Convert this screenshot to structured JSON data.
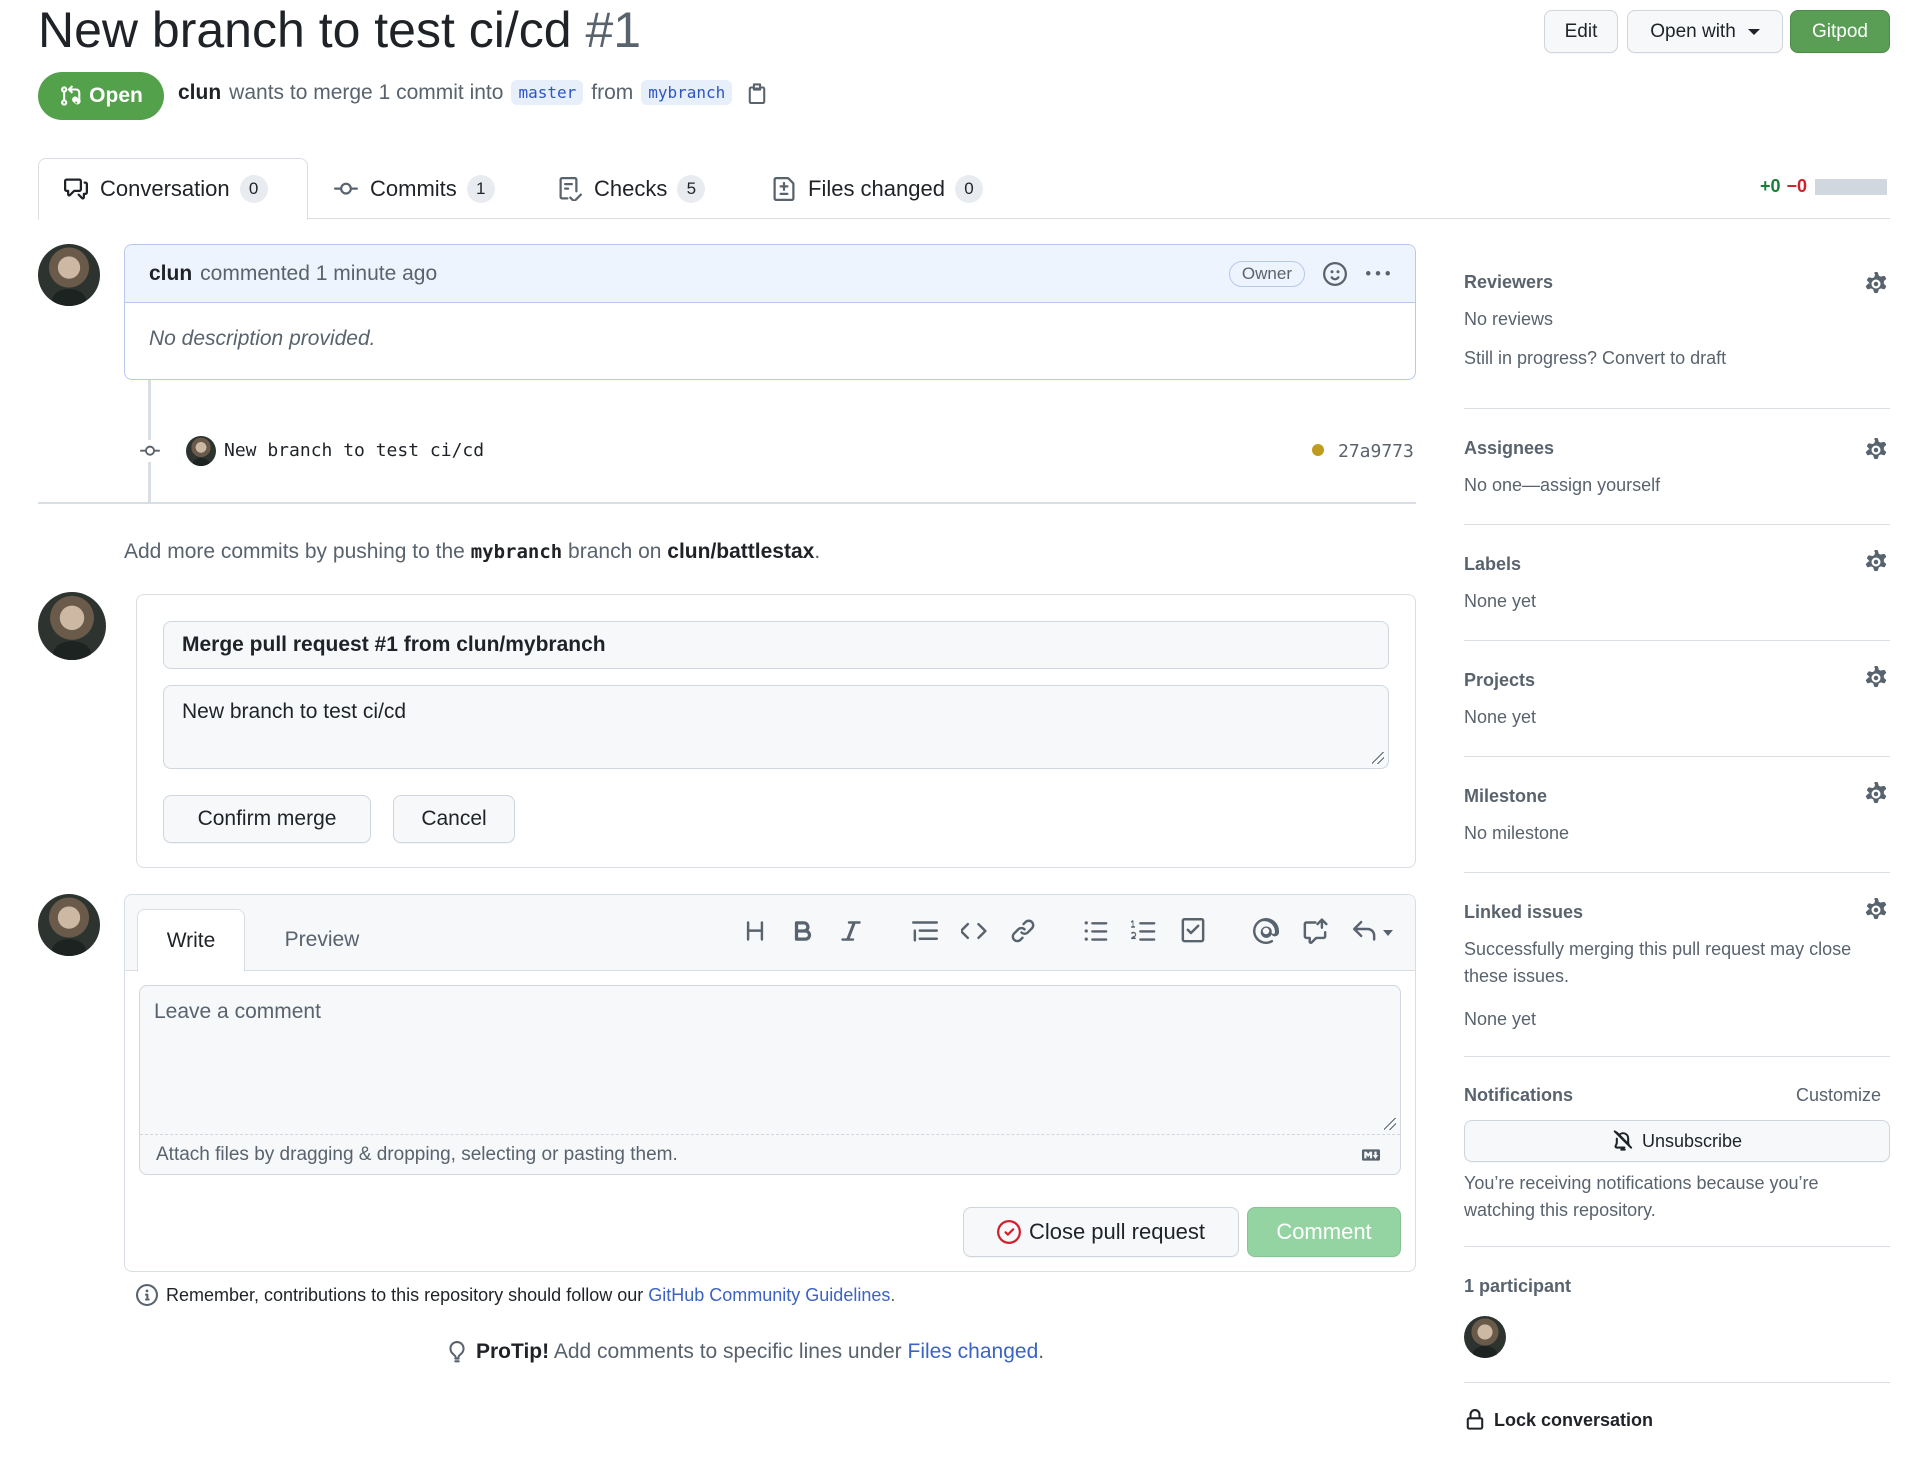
{
  "header": {
    "title": "New branch to test ci/cd",
    "number": "#1",
    "edit_label": "Edit",
    "open_with_label": "Open with",
    "gitpod_label": "Gitpod",
    "state_label": "Open",
    "author": "clun",
    "merge_text": "wants to merge 1 commit into",
    "base_branch": "master",
    "from_text": "from",
    "head_branch": "mybranch"
  },
  "tabs": [
    {
      "label": "Conversation",
      "count": "0"
    },
    {
      "label": "Commits",
      "count": "1"
    },
    {
      "label": "Checks",
      "count": "5"
    },
    {
      "label": "Files changed",
      "count": "0"
    }
  ],
  "diffstat": {
    "additions": "+0",
    "deletions": "−0"
  },
  "comment": {
    "author": "clun",
    "action": "commented 1 minute ago",
    "role_badge": "Owner",
    "body": "No description provided."
  },
  "commit": {
    "message": "New branch to test ci/cd",
    "sha": "27a9773"
  },
  "push_hint": {
    "prefix": "Add more commits by pushing to the",
    "branch": "mybranch",
    "middle": "branch on",
    "repo": "clun/battlestax",
    "suffix": "."
  },
  "merge_form": {
    "title_value": "Merge pull request #1 from clun/mybranch",
    "body_value": "New branch to test ci/cd",
    "confirm_label": "Confirm merge",
    "cancel_label": "Cancel"
  },
  "editor": {
    "write_tab": "Write",
    "preview_tab": "Preview",
    "placeholder": "Leave a comment",
    "attach_text": "Attach files by dragging & dropping, selecting or pasting them.",
    "close_label": "Close pull request",
    "comment_label": "Comment"
  },
  "guidelines": {
    "prefix": "Remember, contributions to this repository should follow our",
    "link": "GitHub Community Guidelines",
    "suffix": "."
  },
  "protip": {
    "label": "ProTip!",
    "text": "Add comments to specific lines under",
    "link": "Files changed",
    "suffix": "."
  },
  "sidebar": {
    "reviewers": {
      "title": "Reviewers",
      "value": "No reviews",
      "hint": "Still in progress? Convert to draft"
    },
    "assignees": {
      "title": "Assignees",
      "value": "No one—assign yourself"
    },
    "labels": {
      "title": "Labels",
      "value": "None yet"
    },
    "projects": {
      "title": "Projects",
      "value": "None yet"
    },
    "milestone": {
      "title": "Milestone",
      "value": "No milestone"
    },
    "linked_issues": {
      "title": "Linked issues",
      "description": "Successfully merging this pull request may close these issues.",
      "value": "None yet"
    },
    "notifications": {
      "title": "Notifications",
      "customize": "Customize",
      "unsubscribe": "Unsubscribe",
      "reason": "You’re receiving notifications because you’re watching this repository."
    },
    "participants": {
      "title": "1 participant"
    },
    "lock": "Lock conversation"
  },
  "colors": {
    "accent_green": "#2da44e",
    "link_blue": "#3b63c4",
    "addition": "#1a7f37",
    "deletion": "#cf222e"
  }
}
